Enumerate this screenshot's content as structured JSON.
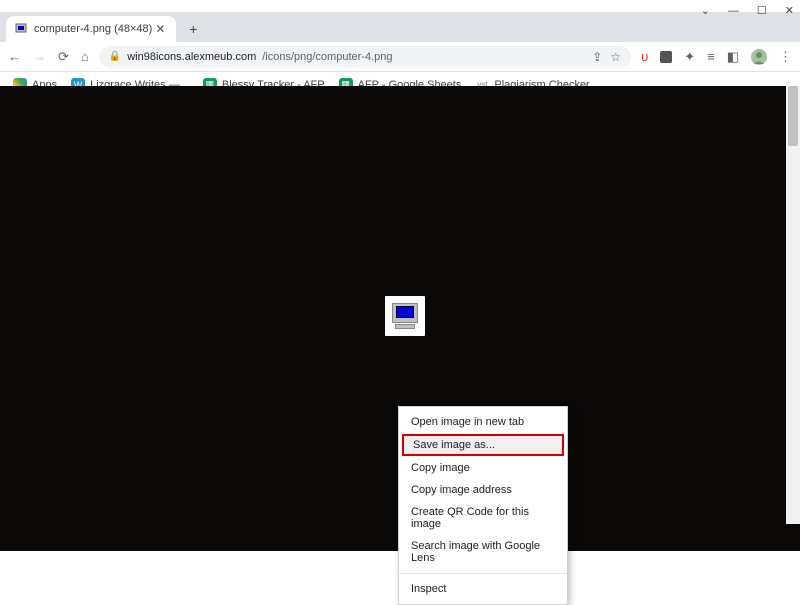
{
  "window_controls": {
    "min": "—",
    "max": "☐",
    "close": "✕",
    "chevron": "⌄"
  },
  "tab": {
    "title": "computer-4.png (48×48)"
  },
  "url": {
    "host": "win98icons.alexmeub.com",
    "path": "/icons/png/computer-4.png"
  },
  "bookmarks": {
    "apps": "Apps",
    "items": [
      {
        "label": "Lizgrace Writes —...",
        "color": "#2196c9"
      },
      {
        "label": "Blessy Tracker - AFP",
        "color": "#0f9d58"
      },
      {
        "label": "AFP - Google Sheets",
        "color": "#0f9d58"
      },
      {
        "label": "Plagiarism Checker...",
        "color": "#888888",
        "textIcon": "vst"
      }
    ]
  },
  "context_menu": {
    "items": [
      "Open image in new tab",
      "Save image as...",
      "Copy image",
      "Copy image address",
      "Create QR Code for this image",
      "Search image with Google Lens"
    ],
    "inspect": "Inspect",
    "highlighted_index": 1
  }
}
